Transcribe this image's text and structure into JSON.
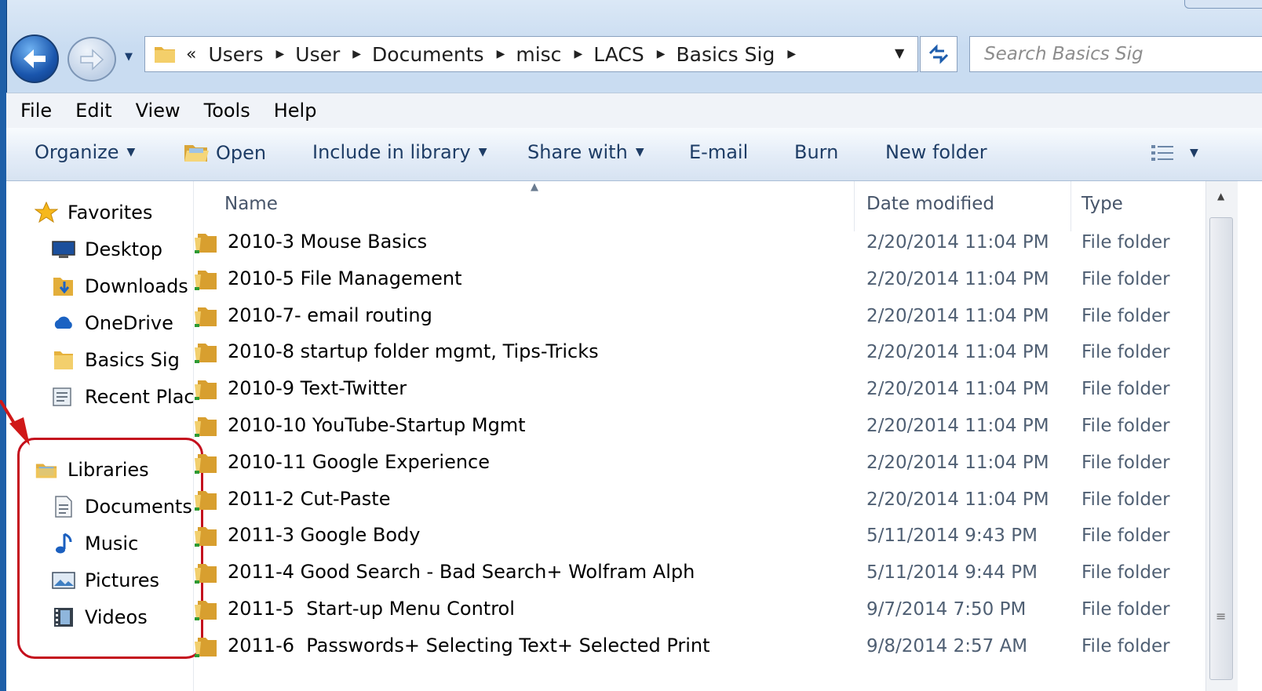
{
  "address": {
    "overflow_glyph": "«",
    "crumbs": [
      "Users",
      "User",
      "Documents",
      "misc",
      "LACS",
      "Basics Sig"
    ]
  },
  "search": {
    "placeholder": "Search Basics Sig"
  },
  "menu": [
    "File",
    "Edit",
    "View",
    "Tools",
    "Help"
  ],
  "commands": {
    "organize": "Organize",
    "open": "Open",
    "include": "Include in library",
    "share": "Share with",
    "email": "E-mail",
    "burn": "Burn",
    "new_folder": "New folder"
  },
  "nav": {
    "favorites": "Favorites",
    "favorite_items": [
      "Desktop",
      "Downloads",
      "OneDrive",
      "Basics Sig",
      "Recent Plac"
    ],
    "libraries": "Libraries",
    "library_items": [
      "Documents",
      "Music",
      "Pictures",
      "Videos"
    ]
  },
  "columns": {
    "name": "Name",
    "date": "Date modified",
    "type": "Type"
  },
  "files": [
    {
      "name": "2010-3 Mouse Basics",
      "date": "2/20/2014 11:04 PM",
      "type": "File folder"
    },
    {
      "name": "2010-5 File Management",
      "date": "2/20/2014 11:04 PM",
      "type": "File folder"
    },
    {
      "name": "2010-7- email routing",
      "date": "2/20/2014 11:04 PM",
      "type": "File folder"
    },
    {
      "name": "2010-8 startup folder mgmt, Tips-Tricks",
      "date": "2/20/2014 11:04 PM",
      "type": "File folder"
    },
    {
      "name": "2010-9 Text-Twitter",
      "date": "2/20/2014 11:04 PM",
      "type": "File folder"
    },
    {
      "name": "2010-10 YouTube-Startup Mgmt",
      "date": "2/20/2014 11:04 PM",
      "type": "File folder"
    },
    {
      "name": "2010-11 Google Experience",
      "date": "2/20/2014 11:04 PM",
      "type": "File folder"
    },
    {
      "name": "2011-2 Cut-Paste",
      "date": "2/20/2014 11:04 PM",
      "type": "File folder"
    },
    {
      "name": "2011-3 Google Body",
      "date": "5/11/2014 9:43 PM",
      "type": "File folder"
    },
    {
      "name": "2011-4 Good Search - Bad Search+ Wolfram Alph",
      "date": "5/11/2014 9:44 PM",
      "type": "File folder"
    },
    {
      "name": "2011-5  Start-up Menu Control",
      "date": "9/7/2014 7:50 PM",
      "type": "File folder"
    },
    {
      "name": "2011-6  Passwords+ Selecting Text+ Selected Print",
      "date": "9/8/2014 2:57 AM",
      "type": "File folder"
    }
  ],
  "colors": {
    "folder": "#e9b949",
    "highlight": "#c40f1d",
    "window_frame": "#1e5fa8"
  }
}
